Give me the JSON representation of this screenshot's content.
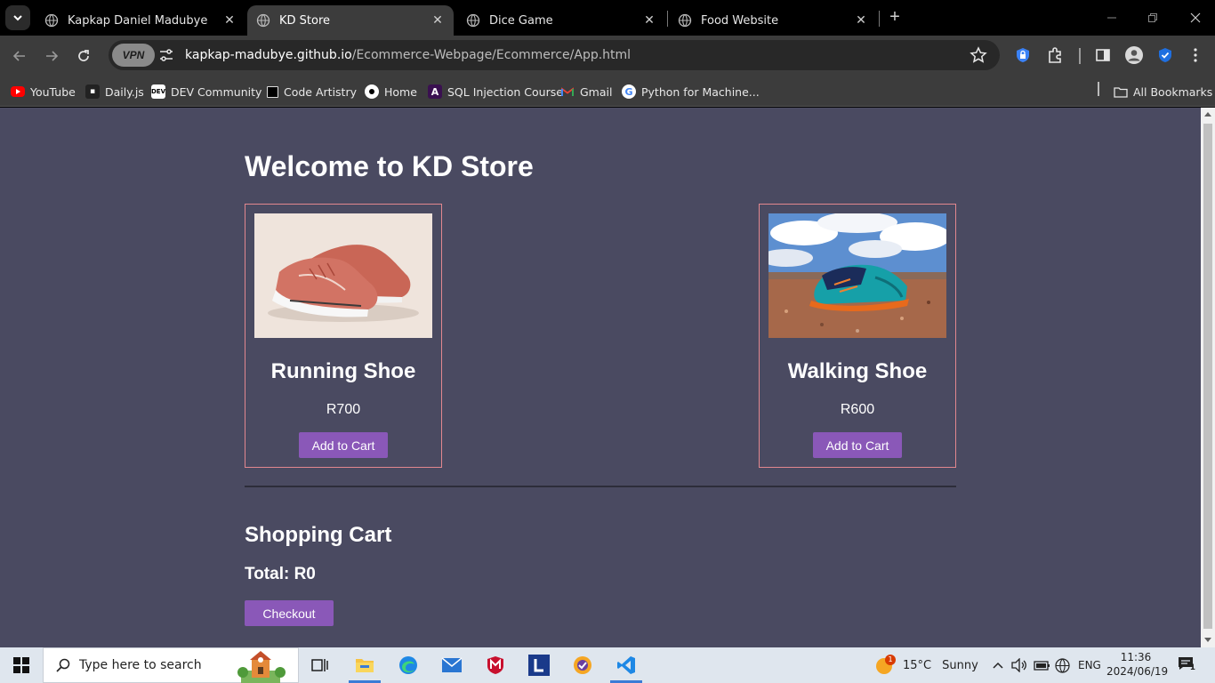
{
  "browser": {
    "tabs": [
      {
        "title": "Kapkap Daniel Madubye",
        "active": false
      },
      {
        "title": "KD Store",
        "active": true
      },
      {
        "title": "Dice Game",
        "active": false
      },
      {
        "title": "Food Website",
        "active": false
      }
    ],
    "vpn_label": "VPN",
    "url_host": "kapkap-madubye.github.io",
    "url_path": "/Ecommerce-Webpage/Ecommerce/App.html",
    "bookmarks": [
      {
        "label": "YouTube",
        "icon": "youtube-icon"
      },
      {
        "label": "Daily.js",
        "icon": "daily-icon"
      },
      {
        "label": "DEV Community",
        "icon": "dev-icon"
      },
      {
        "label": "Code Artistry",
        "icon": "code-artistry-icon"
      },
      {
        "label": "Home",
        "icon": "home-icon"
      },
      {
        "label": "SQL Injection Course",
        "icon": "sql-icon"
      },
      {
        "label": "Gmail",
        "icon": "gmail-icon"
      },
      {
        "label": "Python for Machine...",
        "icon": "google-icon"
      }
    ],
    "all_bookmarks_label": "All Bookmarks"
  },
  "page": {
    "title": "Welcome to KD Store",
    "products": [
      {
        "name": "Running Shoe",
        "price": "R700",
        "button": "Add to Cart"
      },
      {
        "name": "Walking Shoe",
        "price": "R600",
        "button": "Add to Cart"
      }
    ],
    "cart": {
      "title": "Shopping Cart",
      "total": "Total: R0",
      "checkout": "Checkout"
    }
  },
  "taskbar": {
    "search_placeholder": "Type here to search",
    "weather_badge": "1",
    "weather_temp": "15°C",
    "weather_desc": "Sunny",
    "language": "ENG",
    "time": "11:36",
    "date": "2024/06/19",
    "notification_count": "1"
  },
  "colors": {
    "page_bg": "#4a4a61",
    "card_border": "#e2878f",
    "button": "#8a58b8"
  }
}
